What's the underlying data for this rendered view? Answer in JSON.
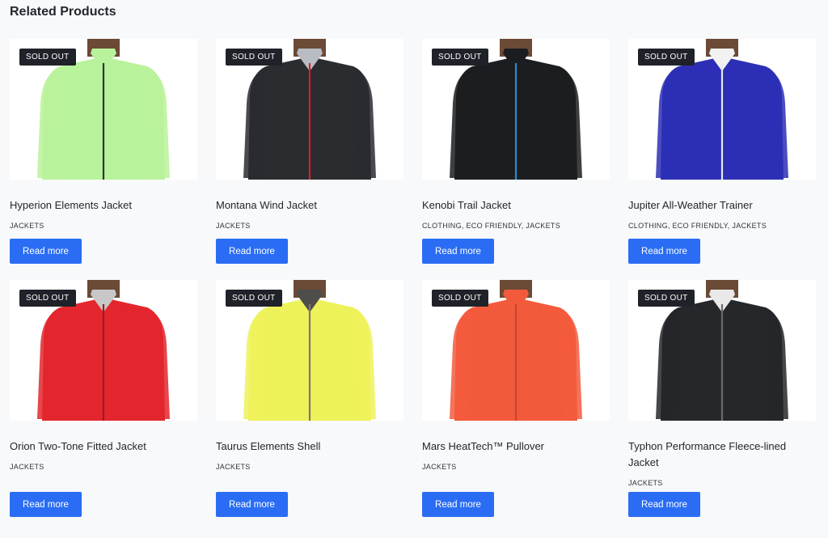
{
  "section": {
    "title": "Related Products"
  },
  "colors": {
    "accent": "#2a6df4",
    "badge_bg": "#1f2229"
  },
  "products": [
    {
      "name": "Hyperion Elements Jacket",
      "categories": "JACKETS",
      "badge": "SOLD OUT",
      "button": "Read more",
      "garment": "#b8f29a",
      "zip": "#333333",
      "inner": "#b8f29a"
    },
    {
      "name": "Montana Wind Jacket",
      "categories": "JACKETS",
      "badge": "SOLD OUT",
      "button": "Read more",
      "garment": "#2a2c30",
      "zip": "#d0232c",
      "inner": "#b9bcc2"
    },
    {
      "name": "Kenobi Trail Jacket",
      "categories": "CLOTHING, ECO FRIENDLY, JACKETS",
      "badge": "SOLD OUT",
      "button": "Read more",
      "garment": "#1c1d20",
      "zip": "#1a8fd6",
      "inner": "#1c1d20"
    },
    {
      "name": "Jupiter All-Weather Trainer",
      "categories": "CLOTHING, ECO FRIENDLY, JACKETS",
      "badge": "SOLD OUT",
      "button": "Read more",
      "garment": "#2c2fb5",
      "zip": "#e8e8f0",
      "inner": "#f2f2f2"
    },
    {
      "name": "Orion Two-Tone Fitted Jacket",
      "categories": "JACKETS",
      "badge": "SOLD OUT",
      "button": "Read more",
      "garment": "#e3262e",
      "zip": "#a01a20",
      "inner": "#c8c8c8"
    },
    {
      "name": "Taurus Elements Shell",
      "categories": "JACKETS",
      "badge": "SOLD OUT",
      "button": "Read more",
      "garment": "#eef25a",
      "zip": "#7a7a6a",
      "inner": "#4d4d4a"
    },
    {
      "name": "Mars HeatTech™ Pullover",
      "categories": "JACKETS",
      "badge": "SOLD OUT",
      "button": "Read more",
      "garment": "#f35a3c",
      "zip": "#c94530",
      "inner": "#f35a3c"
    },
    {
      "name": "Typhon Performance Fleece-lined Jacket",
      "categories": "JACKETS",
      "badge": "SOLD OUT",
      "button": "Read more",
      "garment": "#26272a",
      "zip": "#6a6a6a",
      "inner": "#e9e9e9"
    }
  ]
}
